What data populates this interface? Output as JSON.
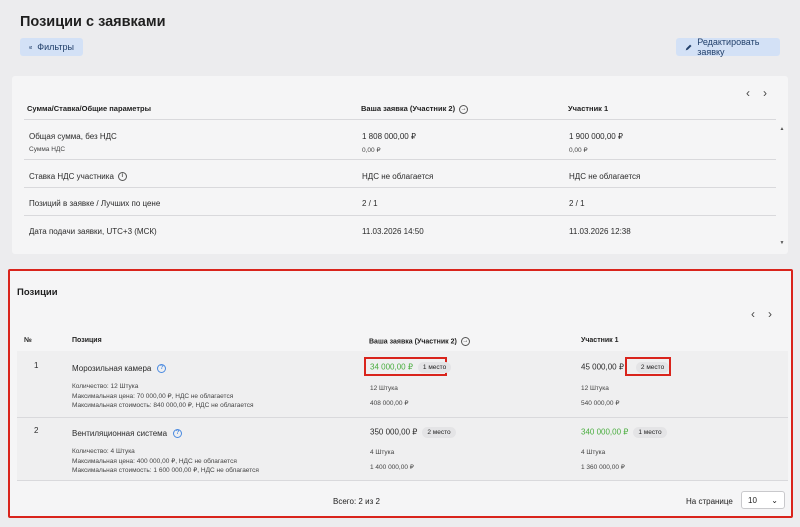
{
  "header": {
    "title": "Позиции с заявками",
    "filters_label": "Фильтры",
    "edit_label": "Редактировать заявку"
  },
  "summary_table": {
    "columns": [
      "Сумма/Ставка/Общие параметры",
      "Ваша заявка (Участник 2)",
      "Участник 1"
    ],
    "rows": [
      {
        "label": "Общая сумма, без НДС",
        "sub": "Сумма НДС",
        "your": "1 808 000,00 ₽",
        "your_sub": "0,00 ₽",
        "p1": "1 900 000,00 ₽",
        "p1_sub": "0,00 ₽"
      },
      {
        "label": "Ставка НДС участника",
        "your": "НДС не облагается",
        "p1": "НДС не облагается"
      },
      {
        "label": "Позиций в заявке / Лучших по цене",
        "your": "2 / 1",
        "p1": "2 / 1"
      },
      {
        "label": "Дата подачи заявки, UTC+3 (МСК)",
        "your": "11.03.2026 14:50",
        "p1": "11.03.2026 12:38"
      }
    ]
  },
  "positions": {
    "title": "Позиции",
    "columns": [
      "№",
      "Позиция",
      "Ваша заявка (Участник 2)",
      "Участник 1"
    ],
    "items": [
      {
        "num": "1",
        "name": "Морозильная камера",
        "details": [
          "Количество: 12 Штука",
          "Максимальная цена: 70 000,00 ₽, НДС не облагается",
          "Максимальная стоимость: 840 000,00 ₽, НДС не облагается"
        ],
        "your_price": "34 000,00 ₽",
        "your_place": "1 место",
        "your_qty": "12 Штука",
        "your_total": "408 000,00 ₽",
        "p1_price": "45 000,00 ₽",
        "p1_place": "2 место",
        "p1_qty": "12 Штука",
        "p1_total": "540 000,00 ₽"
      },
      {
        "num": "2",
        "name": "Вентиляционная система",
        "details": [
          "Количество: 4 Штука",
          "Максимальная цена: 400 000,00 ₽, НДС не облагается",
          "Максимальная стоимость: 1 600 000,00 ₽, НДС не облагается"
        ],
        "your_price": "350 000,00 ₽",
        "your_place": "2 место",
        "your_qty": "4 Штука",
        "your_total": "1 400 000,00 ₽",
        "p1_price": "340 000,00 ₽",
        "p1_place": "1 место",
        "p1_qty": "4 Штука",
        "p1_total": "1 360 000,00 ₽"
      }
    ],
    "total_label": "Всего: 2 из 2",
    "per_page_label": "На странице",
    "per_page_value": "10"
  },
  "colors": {
    "accent_button": "#d3e1f6",
    "highlight_red": "#d9241c",
    "best_price_green": "#49ad3e"
  }
}
